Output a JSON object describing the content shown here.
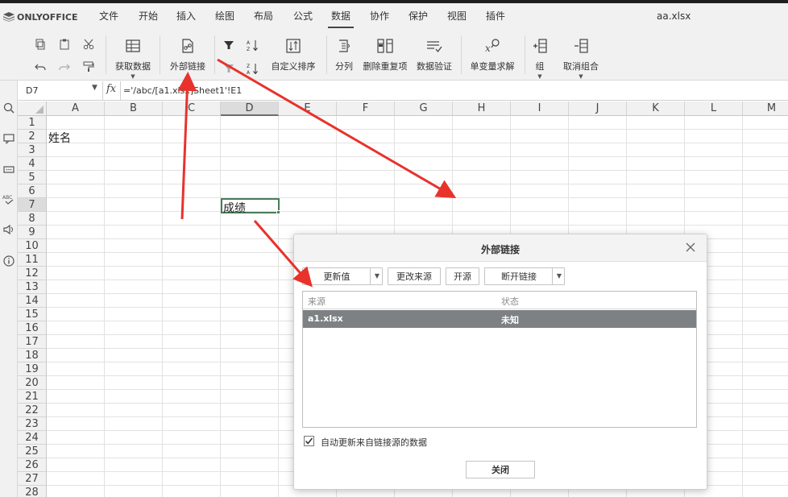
{
  "app": {
    "logo_text": "ONLYOFFICE",
    "filename": "aa.xlsx"
  },
  "menu": {
    "tabs": [
      "文件",
      "开始",
      "插入",
      "绘图",
      "布局",
      "公式",
      "数据",
      "协作",
      "保护",
      "视图",
      "插件"
    ],
    "active_tab": "数据"
  },
  "toolbar": {
    "get_data": "获取数据",
    "external_links": "外部链接",
    "custom_sort": "自定义排序",
    "text_to_columns": "分列",
    "remove_duplicates": "删除重复项",
    "data_validation": "数据验证",
    "goal_seek": "单变量求解",
    "group": "组",
    "ungroup": "取消组合"
  },
  "formula_bar": {
    "cell_ref": "D7",
    "fx": "fx",
    "formula": "='/abc/[a1.xlsx]Sheet1'!E1"
  },
  "sheet": {
    "columns": [
      "A",
      "B",
      "C",
      "D",
      "E",
      "F",
      "G",
      "H",
      "I",
      "J",
      "K",
      "L",
      "M"
    ],
    "selected_column": "D",
    "rows": [
      "1",
      "2",
      "3",
      "4",
      "5",
      "6",
      "7",
      "8",
      "9",
      "10",
      "11",
      "12",
      "13",
      "14",
      "15",
      "16",
      "17",
      "18",
      "19",
      "20",
      "21",
      "22",
      "23",
      "24",
      "25",
      "26",
      "27",
      "28"
    ],
    "selected_row": "7",
    "cells": {
      "A2": "姓名",
      "D7": "成绩"
    }
  },
  "dialog": {
    "title": "外部链接",
    "update_values": "更新值",
    "change_source": "更改来源",
    "open_source": "开源",
    "break_link": "断开链接",
    "list_header_source": "来源",
    "list_header_status": "状态",
    "rows": [
      {
        "source": "a1.xlsx",
        "status": "未知"
      }
    ],
    "auto_update_checked": true,
    "auto_update_label": "自动更新来自链接源的数据",
    "close": "关闭"
  },
  "colors": {
    "accent_green": "#4a7c59",
    "annotation_red": "#e8322c",
    "selected_row": "#7e8184"
  }
}
